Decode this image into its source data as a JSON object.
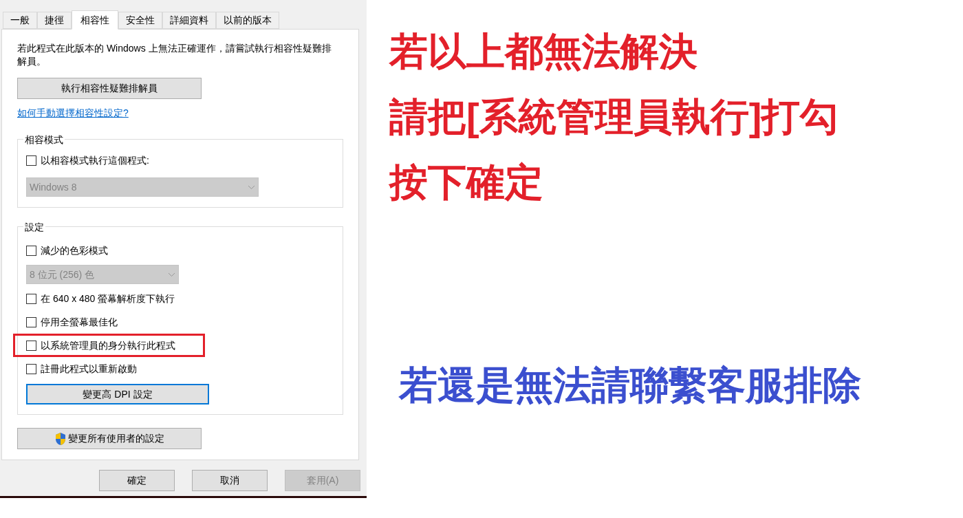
{
  "tabs": [
    {
      "label": "一般",
      "selected": false
    },
    {
      "label": "捷徑",
      "selected": false
    },
    {
      "label": "相容性",
      "selected": true
    },
    {
      "label": "安全性",
      "selected": false
    },
    {
      "label": "詳細資料",
      "selected": false
    },
    {
      "label": "以前的版本",
      "selected": false
    }
  ],
  "description": "若此程式在此版本的 Windows 上無法正確運作，請嘗試執行相容性疑難排解員。",
  "troubleshoot_button": "執行相容性疑難排解員",
  "help_link": "如何手動選擇相容性設定?",
  "compat_mode": {
    "title": "相容模式",
    "checkbox": {
      "label": "以相容模式執行這個程式:",
      "checked": false
    },
    "dropdown": {
      "value": "Windows 8",
      "disabled": true
    }
  },
  "settings": {
    "title": "設定",
    "items": [
      {
        "kind": "checkbox",
        "label": "減少的色彩模式",
        "checked": false,
        "highlighted": false
      },
      {
        "kind": "dropdown",
        "value": "8 位元 (256) 色",
        "disabled": true
      },
      {
        "kind": "checkbox",
        "label": "在 640 x 480 螢幕解析度下執行",
        "checked": false,
        "highlighted": false
      },
      {
        "kind": "checkbox",
        "label": "停用全螢幕最佳化",
        "checked": false,
        "highlighted": false
      },
      {
        "kind": "checkbox",
        "label": "以系統管理員的身分執行此程式",
        "checked": false,
        "highlighted": true
      },
      {
        "kind": "checkbox",
        "label": "註冊此程式以重新啟動",
        "checked": false,
        "highlighted": false
      },
      {
        "kind": "button",
        "label": "變更高 DPI 設定"
      }
    ]
  },
  "all_users_button": "變更所有使用者的設定",
  "footer_buttons": [
    {
      "label": "確定",
      "disabled": false
    },
    {
      "label": "取消",
      "disabled": false
    },
    {
      "label": "套用(A)",
      "disabled": true
    }
  ],
  "notes": [
    {
      "text": "若以上都無法解決",
      "color": "#e3202a"
    },
    {
      "text": "請把[系統管理員執行]打勾",
      "color": "#e3202a"
    },
    {
      "text": "按下確定",
      "color": "#e3202a"
    },
    {
      "text": "若還是無法請聯繫客服排除",
      "color": "#3b4fcf"
    }
  ]
}
